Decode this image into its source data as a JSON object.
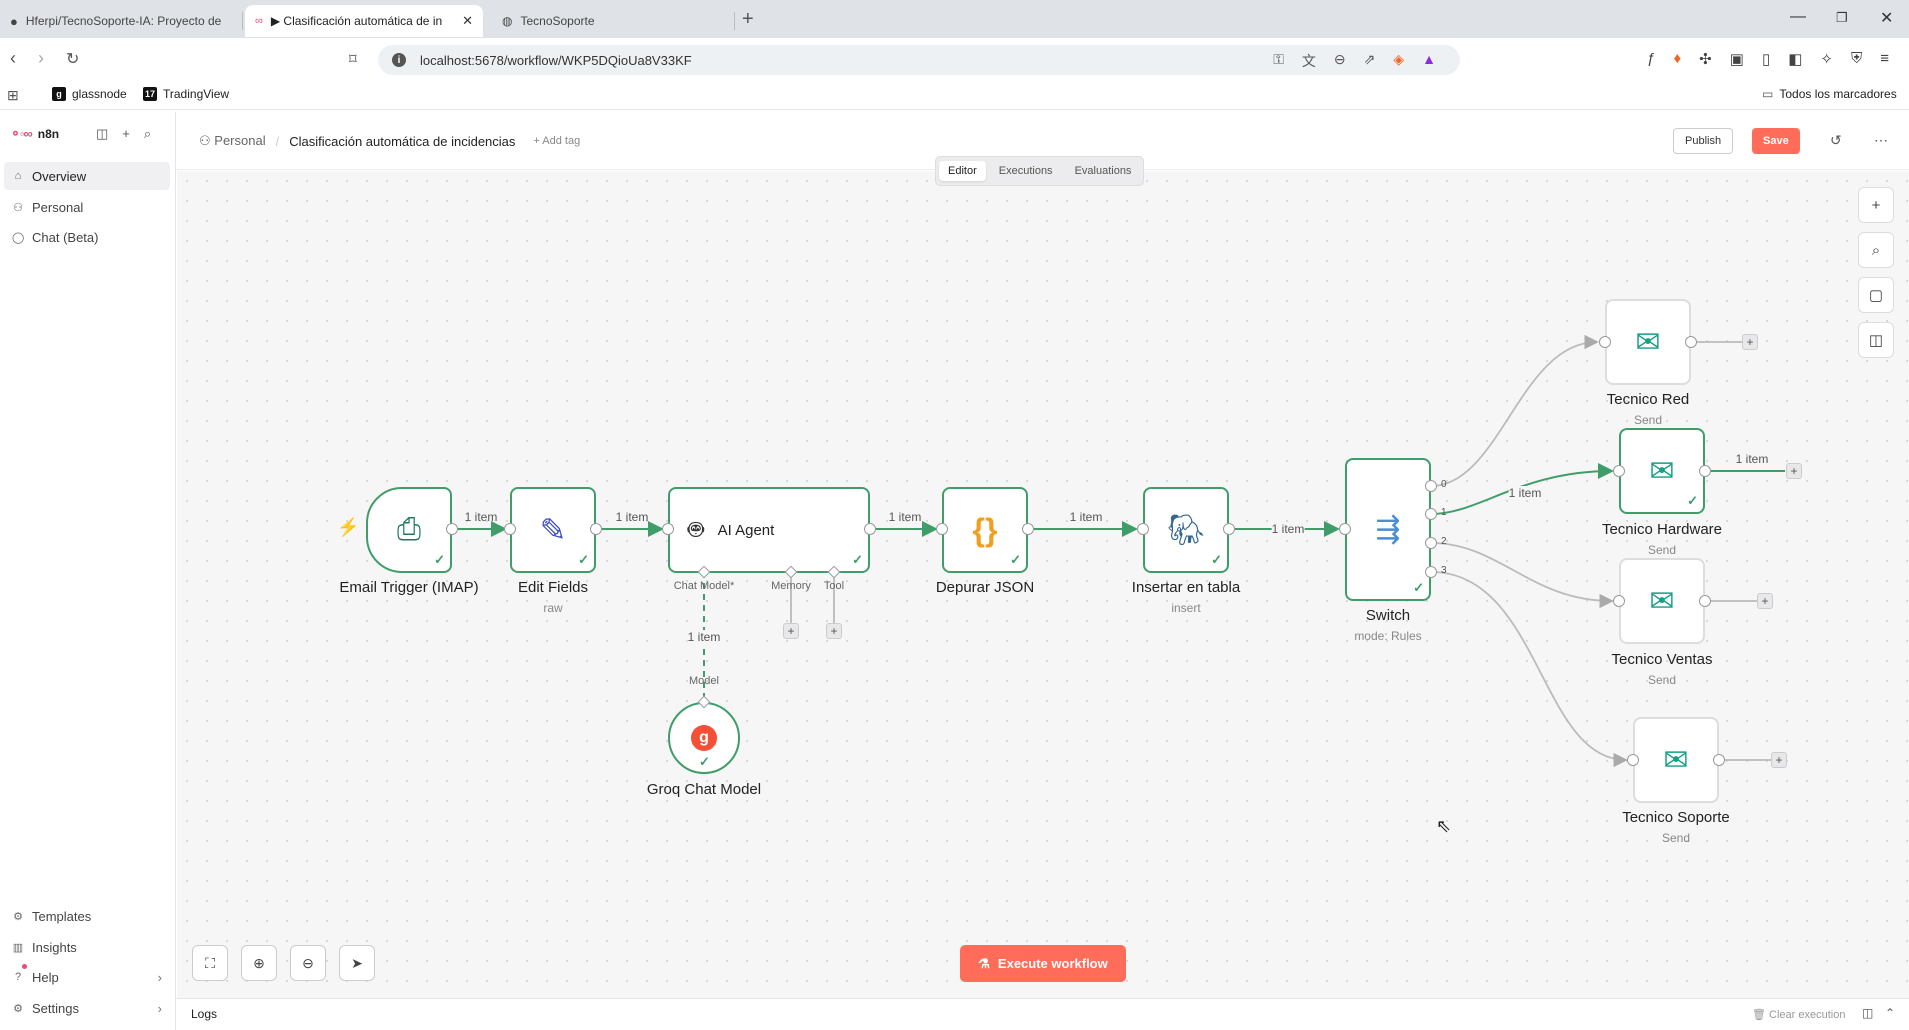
{
  "browser": {
    "tabs": [
      {
        "title": "Hferpi/TecnoSoporte-IA: Proyecto de"
      },
      {
        "title": "▶ Clasificación automática de in"
      },
      {
        "title": "TecnoSoporte"
      }
    ],
    "url": "localhost:5678/workflow/WKP5DQioUa8V33KF",
    "bookmarks": [
      "glassnode",
      "TradingView"
    ],
    "all_bookmarks": "Todos los marcadores"
  },
  "app": {
    "brand": "n8n",
    "sidebar": {
      "top": [
        "Overview",
        "Personal",
        "Chat (Beta)"
      ],
      "bottom": [
        "Templates",
        "Insights",
        "Help",
        "Settings"
      ]
    },
    "header": {
      "project": "Personal",
      "workflow_title": "Clasificación automática de incidencias",
      "add_tag": "+ Add tag",
      "publish": "Publish",
      "save": "Save"
    },
    "view_tabs": [
      "Editor",
      "Executions",
      "Evaluations"
    ],
    "execute": "Execute workflow",
    "logs": "Logs",
    "clear_execution": "Clear execution"
  },
  "workflow": {
    "nodes": {
      "email": {
        "label": "Email Trigger (IMAP)",
        "sub": ""
      },
      "edit": {
        "label": "Edit Fields",
        "sub": "raw"
      },
      "agent": {
        "label": "AI Agent",
        "sub": ""
      },
      "json": {
        "label": "Depurar JSON",
        "sub": ""
      },
      "table": {
        "label": "Insertar en tabla",
        "sub": "insert"
      },
      "switch": {
        "label": "Switch",
        "sub": "mode: Rules"
      },
      "groq": {
        "label": "Groq Chat Model",
        "sub": ""
      },
      "red": {
        "label": "Tecnico Red",
        "sub": "Send"
      },
      "hardware": {
        "label": "Tecnico Hardware",
        "sub": "Send"
      },
      "ventas": {
        "label": "Tecnico Ventas",
        "sub": "Send"
      },
      "soporte": {
        "label": "Tecnico Soporte",
        "sub": "Send"
      }
    },
    "agent_inputs": {
      "chat_model": "Chat Model*",
      "memory": "Memory",
      "tool": "Tool"
    },
    "model_label": "Model",
    "edge_label": "1 item",
    "switch_outputs": [
      "0",
      "1",
      "2",
      "3"
    ]
  }
}
